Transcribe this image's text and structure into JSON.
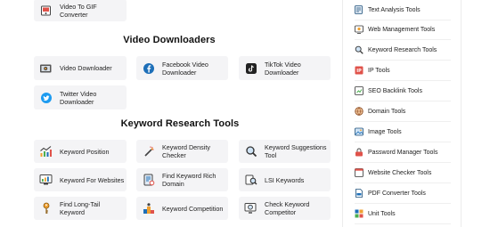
{
  "top_card": {
    "label": "Video To GIF Converter",
    "icon": "video-gif-icon"
  },
  "video_downloaders": {
    "title": "Video Downloaders",
    "tools": [
      {
        "label": "Video Downloader",
        "icon": "video-download-icon"
      },
      {
        "label": "Facebook Video\nDownloader",
        "icon": "facebook-icon"
      },
      {
        "label": "TikTok Video\nDownloader",
        "icon": "tiktok-icon"
      },
      {
        "label": "Twitter Video\nDownloader",
        "icon": "twitter-icon"
      }
    ]
  },
  "keyword_research": {
    "title": "Keyword Research Tools",
    "tools": [
      {
        "label": "Keyword Position",
        "icon": "chart-up-icon"
      },
      {
        "label": "Keyword Density\nChecker",
        "icon": "magic-wand-icon"
      },
      {
        "label": "Keyword Suggestions\nTool",
        "icon": "magnifier-icon"
      },
      {
        "label": "Keyword For Websites",
        "icon": "chart-screen-icon"
      },
      {
        "label": "Find Keyword Rich\nDomain",
        "icon": "domain-doc-icon"
      },
      {
        "label": "LSI Keywords",
        "icon": "lsi-search-icon"
      },
      {
        "label": "Find Long-Tail Keyword",
        "icon": "key-icon"
      },
      {
        "label": "Keyword Competition",
        "icon": "competition-icon"
      },
      {
        "label": "Check Keyword\nCompetitor",
        "icon": "keyword-competitor-icon"
      }
    ]
  },
  "sidebar": {
    "items": [
      {
        "label": "Text Analysis Tools",
        "icon": "text-analysis-icon"
      },
      {
        "label": "Web Management Tools",
        "icon": "web-management-icon"
      },
      {
        "label": "Keyword Research Tools",
        "icon": "keyword-research-icon"
      },
      {
        "label": "IP Tools",
        "icon": "ip-icon"
      },
      {
        "label": "SEO Backlink Tools",
        "icon": "seo-backlink-icon"
      },
      {
        "label": "Domain Tools",
        "icon": "domain-icon"
      },
      {
        "label": "Image Tools",
        "icon": "image-icon"
      },
      {
        "label": "Password Manager Tools",
        "icon": "password-icon"
      },
      {
        "label": "Website Checker Tools",
        "icon": "website-checker-icon"
      },
      {
        "label": "PDF Converter Tools",
        "icon": "pdf-icon"
      },
      {
        "label": "Unit Tools",
        "icon": "unit-icon"
      }
    ]
  },
  "colors": {
    "card_bg": "#f4f4f6",
    "accent_blue": "#1d6fb8",
    "accent_red": "#d9534f",
    "accent_orange": "#f0a030"
  }
}
